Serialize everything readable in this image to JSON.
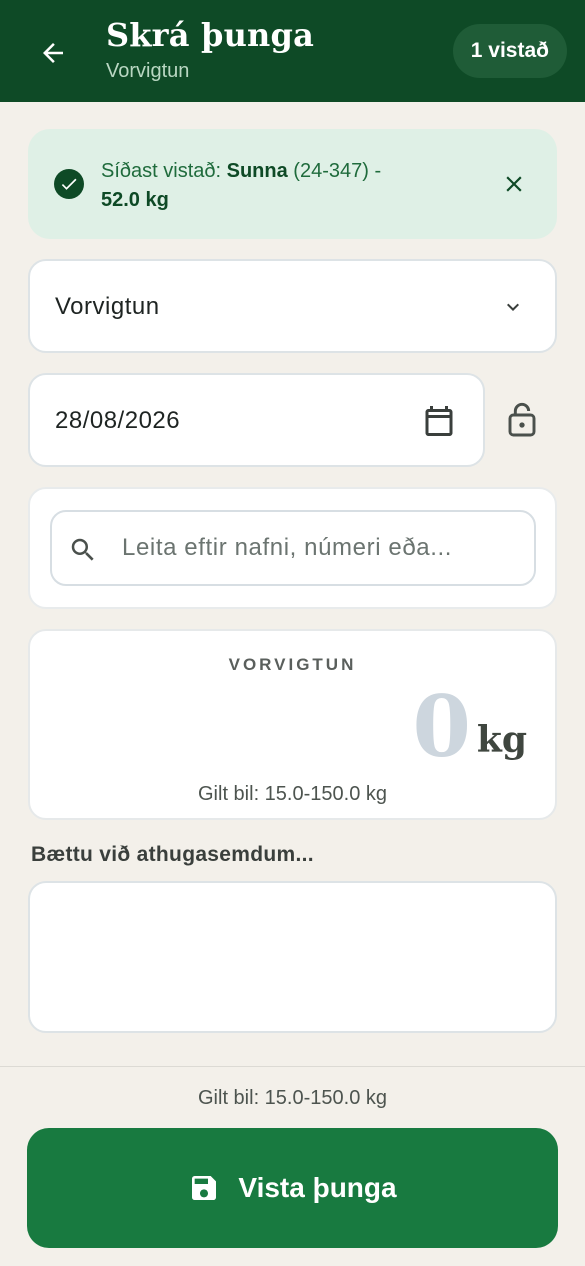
{
  "header": {
    "back_icon": "arrow-left-icon",
    "title": "Skrá þunga",
    "subtitle": "Vorvigtun",
    "saved_count_label": "1 vistað"
  },
  "banner": {
    "icon": "check-circle-icon",
    "prefix": "Síðast vistað: ",
    "animal_name": "Sunna",
    "animal_id": " (24-347) - ",
    "weight": "52.0 kg",
    "close_icon": "close-icon"
  },
  "weighing_type": {
    "selected": "Vorvigtun",
    "icon": "chevron-down-icon"
  },
  "date": {
    "value": "28/08/2026",
    "icon": "calendar-icon",
    "lock_icon": "lock-icon"
  },
  "search": {
    "placeholder": "Leita eftir nafni, númeri eða...",
    "value": ""
  },
  "weight": {
    "label": "VORVIGTUN",
    "value": "0",
    "unit": "kg",
    "valid_range": "Gilt bil: 15.0-150.0 kg"
  },
  "notes": {
    "label": "Bættu við athugasemdum...",
    "value": ""
  },
  "footer": {
    "valid_range": "Gilt bil: 15.0-150.0 kg",
    "save_label": "Vista þunga",
    "save_icon": "floppy-disk-icon"
  },
  "colors": {
    "header_bg": "#0e4a26",
    "accent": "#187a40",
    "banner_bg": "#dff0e6",
    "page_bg": "#f3f0ea"
  }
}
